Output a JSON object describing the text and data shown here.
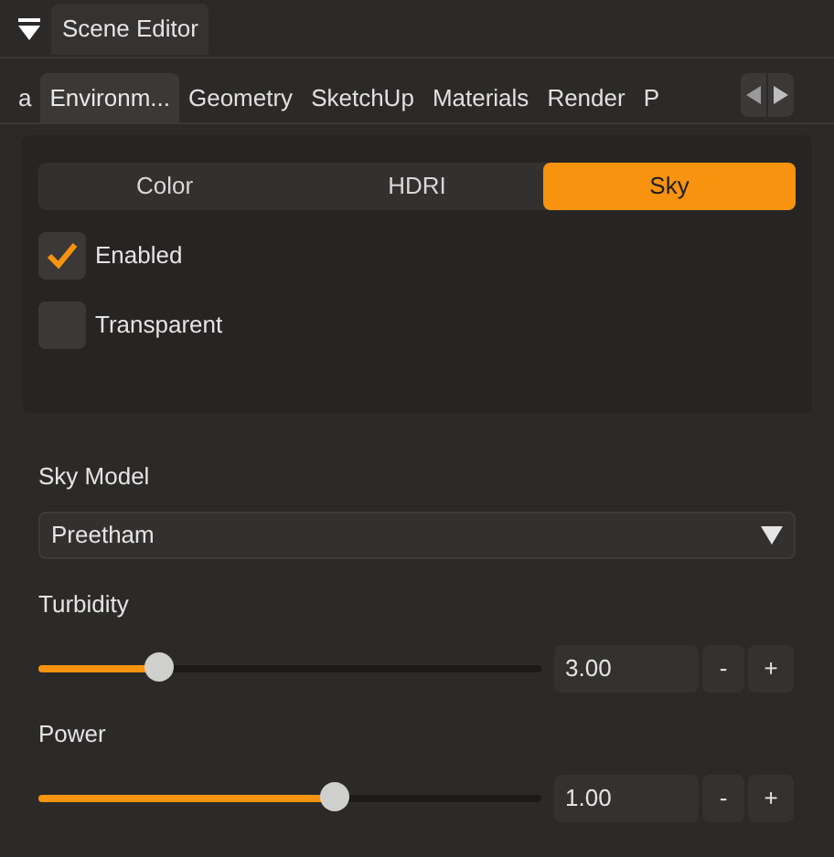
{
  "panel": {
    "title": "Scene Editor",
    "expanded": true
  },
  "tabs": [
    {
      "label": "a",
      "selected": false
    },
    {
      "label": "Environm...",
      "selected": true
    },
    {
      "label": "Geometry",
      "selected": false
    },
    {
      "label": "SketchUp",
      "selected": false
    },
    {
      "label": "Materials",
      "selected": false
    },
    {
      "label": "Render",
      "selected": false
    },
    {
      "label": "P",
      "selected": false
    }
  ],
  "modes": [
    {
      "label": "Color",
      "selected": false
    },
    {
      "label": "HDRI",
      "selected": false
    },
    {
      "label": "Sky",
      "selected": true
    }
  ],
  "checkboxes": [
    {
      "label": "Enabled",
      "checked": true
    },
    {
      "label": "Transparent",
      "checked": false
    }
  ],
  "sky_model": {
    "label": "Sky Model",
    "value": "Preetham"
  },
  "sliders": [
    {
      "label": "Turbidity",
      "level": 0.24,
      "value": "3.00",
      "minus": "-",
      "plus": "+"
    },
    {
      "label": "Power",
      "level": 0.59,
      "value": "1.00",
      "minus": "-",
      "plus": "+"
    }
  ]
}
